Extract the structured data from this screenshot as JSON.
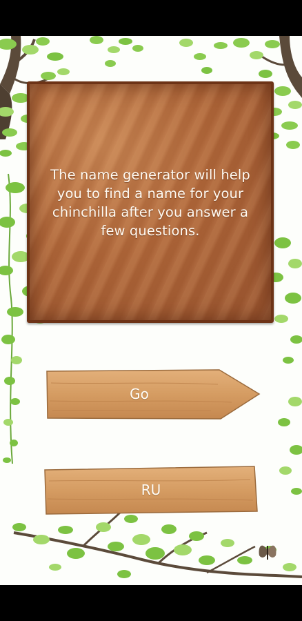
{
  "description": {
    "text": "The name generator will help you to find a name for your chinchilla after you answer a few questions."
  },
  "buttons": {
    "go_label": "Go",
    "language_label": "RU"
  },
  "colors": {
    "board_wood": "#b0673a",
    "board_frame": "#6d3316",
    "plank_wood": "#d9a46a",
    "leaf_green": "#7cc242",
    "branch_brown": "#5b4a3a",
    "background": "#fdfefb"
  },
  "icons": {
    "decoration": [
      "leaf-icon",
      "branch-icon",
      "butterfly-icon"
    ]
  }
}
